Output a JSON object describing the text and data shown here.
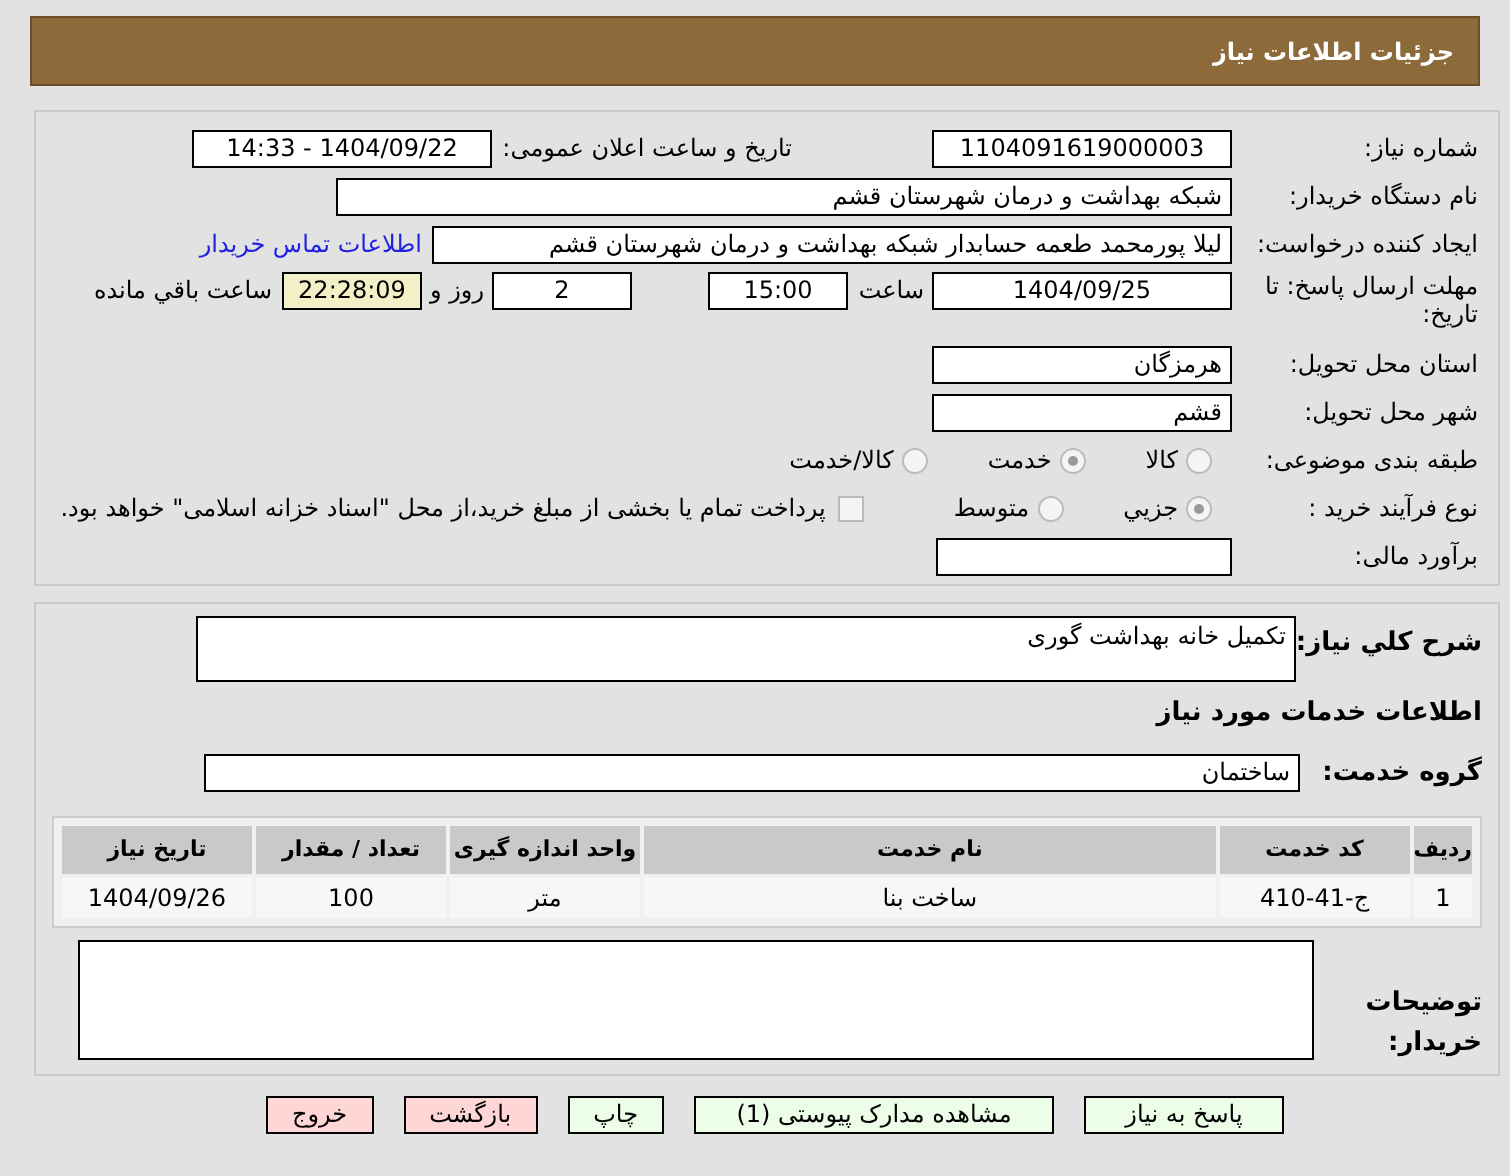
{
  "header": {
    "title": "جزئیات اطلاعات نیاز"
  },
  "details": {
    "need_number": {
      "label": "شماره نیاز:",
      "value": "1104091619000003"
    },
    "announce": {
      "label": "تاریخ و ساعت اعلان عمومی:",
      "value": "1404/09/22 - 14:33"
    },
    "buyer": {
      "label": "نام دستگاه خریدار:",
      "value": "شبکه بهداشت و درمان شهرستان قشم"
    },
    "requester": {
      "label": "ایجاد کننده درخواست:",
      "value": "لیلا پورمحمد طعمه حسابدار شبکه بهداشت و درمان شهرستان قشم",
      "link": "اطلاعات تماس خریدار"
    },
    "deadline": {
      "label": "مهلت ارسال پاسخ: تا تاریخ:",
      "date": "1404/09/25",
      "time_label": "ساعت",
      "time": "15:00",
      "days": "2",
      "days_label": "روز و",
      "remaining": "22:28:09",
      "remaining_label": "ساعت باقي مانده"
    },
    "province": {
      "label": "استان محل تحویل:",
      "value": "هرمزگان"
    },
    "city": {
      "label": "شهر محل تحویل:",
      "value": "قشم"
    },
    "category": {
      "label": "طبقه بندی موضوعی:",
      "options": [
        {
          "label": "کالا",
          "selected": false
        },
        {
          "label": "خدمت",
          "selected": true
        },
        {
          "label": "کالا/خدمت",
          "selected": false
        }
      ]
    },
    "purchase_type": {
      "label": "نوع فرآیند خرید :",
      "options": [
        {
          "label": "جزیي",
          "selected": true
        },
        {
          "label": "متوسط",
          "selected": false
        }
      ],
      "payment_note": {
        "label": "پرداخت تمام یا بخشی از مبلغ خرید،از محل \"اسناد خزانه اسلامی\" خواهد بود.",
        "checked": false
      }
    },
    "budget": {
      "label": "برآورد مالی:"
    }
  },
  "need": {
    "description_label": "شرح کلي نیاز:",
    "description": "تکمیل خانه بهداشت گوری",
    "services_title": "اطلاعات خدمات مورد نیاز",
    "group_label": "گروه خدمت:",
    "group": "ساختمان",
    "table": {
      "columns": [
        "ردیف",
        "کد خدمت",
        "نام خدمت",
        "واحد اندازه گیری",
        "تعداد / مقدار",
        "تاریخ نیاز"
      ],
      "rows": [
        [
          "1",
          "ج-41-410",
          "ساخت بنا",
          "متر",
          "100",
          "1404/09/26"
        ]
      ]
    },
    "notes_label": "توضیحات خریدار:"
  },
  "buttons": [
    {
      "label": "پاسخ به نیاز",
      "kind": "green"
    },
    {
      "label": "مشاهده مدارک پیوستی (1)",
      "kind": "green"
    },
    {
      "label": "چاپ",
      "kind": "green"
    },
    {
      "label": "بازگشت",
      "kind": "red"
    },
    {
      "label": "خروج",
      "kind": "red"
    }
  ]
}
